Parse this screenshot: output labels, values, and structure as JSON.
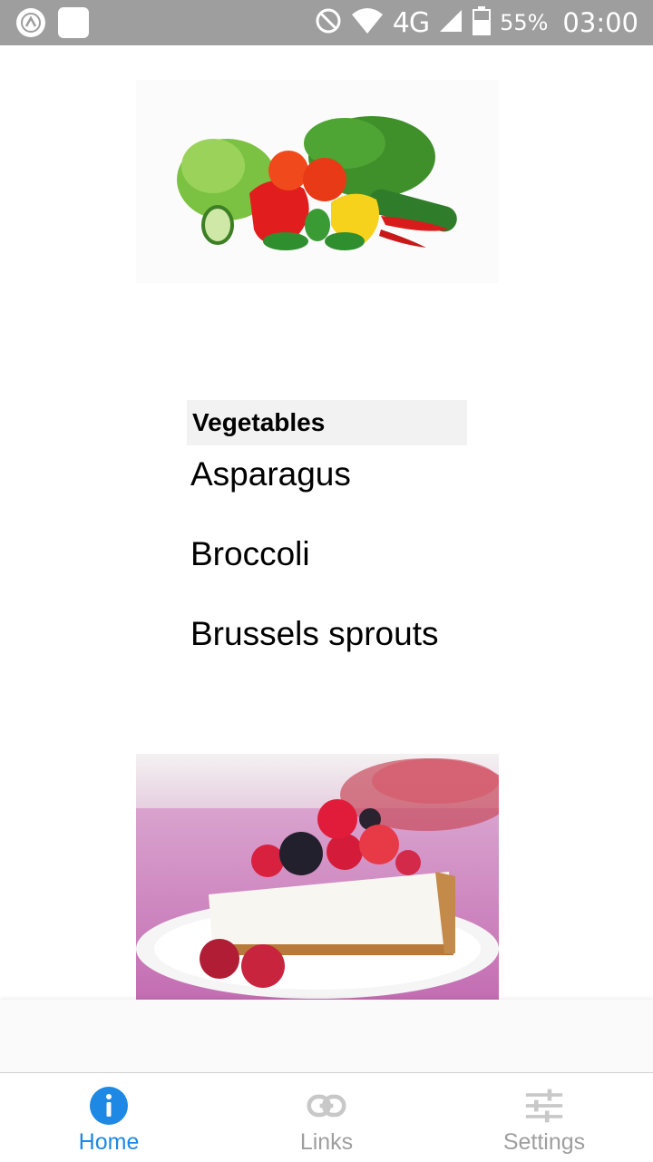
{
  "status_bar": {
    "network": "4G",
    "battery": "55%",
    "time": "03:00"
  },
  "images": {
    "vegetables_icon": "vegetables-image",
    "dessert_icon": "cheesecake-image"
  },
  "list": {
    "header": "Vegetables",
    "items": [
      "Asparagus",
      "Broccoli",
      "Brussels sprouts"
    ]
  },
  "tabs": [
    {
      "label": "Home",
      "icon": "info-icon",
      "active": true
    },
    {
      "label": "Links",
      "icon": "link-icon",
      "active": false
    },
    {
      "label": "Settings",
      "icon": "sliders-icon",
      "active": false
    }
  ],
  "colors": {
    "accent": "#1e88e5",
    "inactive": "#9e9e9e",
    "status_bar": "#9e9e9e"
  }
}
